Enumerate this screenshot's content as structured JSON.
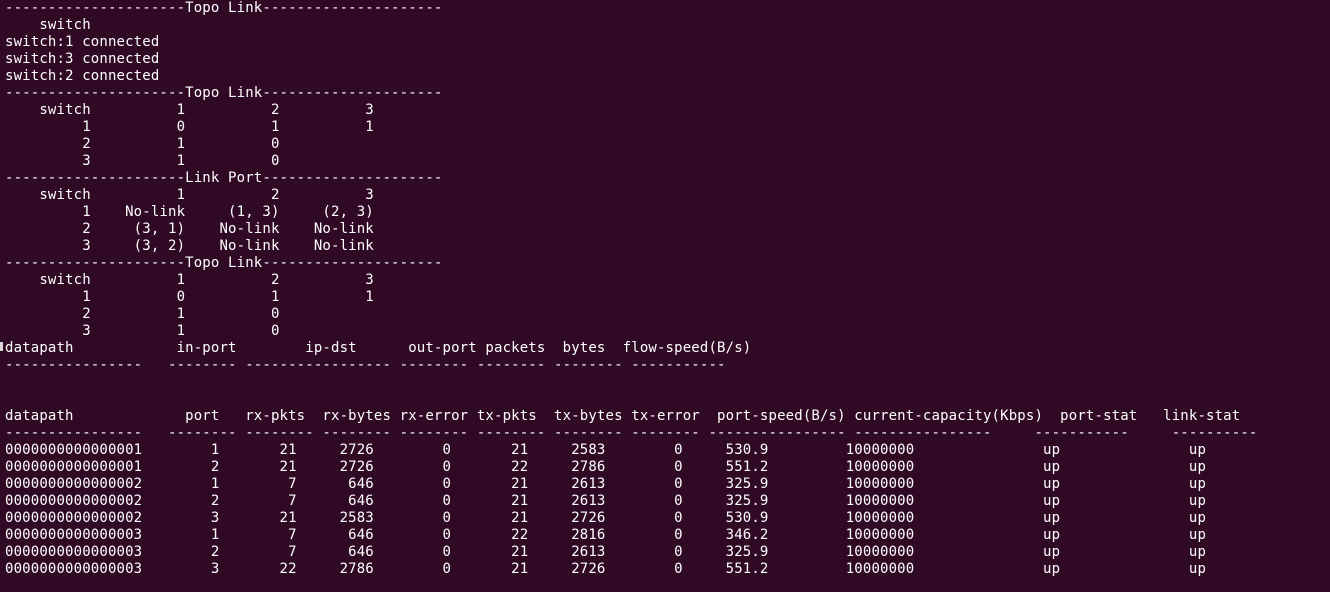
{
  "terminal": {
    "background": "#300a24",
    "foreground": "#ffffff",
    "lines": [
      "---------------------Topo Link---------------------",
      "    switch",
      "switch:1 connected",
      "switch:3 connected",
      "switch:2 connected",
      "---------------------Topo Link---------------------",
      "    switch          1          2          3",
      "         1          0          1          1",
      "         2          1          0",
      "         3          1          0",
      "---------------------Link Port---------------------",
      "    switch          1          2          3",
      "         1    No-link     (1, 3)     (2, 3)",
      "         2     (3, 1)    No-link    No-link",
      "         3     (3, 2)    No-link    No-link",
      "---------------------Topo Link---------------------",
      "    switch          1          2          3",
      "         1          0          1          1",
      "         2          1          0",
      "         3          1          0",
      "datapath            in-port        ip-dst      out-port packets  bytes  flow-speed(B/s)",
      "----------------   -------- ----------------- -------- -------- -------- -----------",
      "",
      "",
      "datapath             port   rx-pkts  rx-bytes rx-error tx-pkts  tx-bytes tx-error  port-speed(B/s) current-capacity(Kbps)  port-stat   link-stat",
      "----------------   -------- -------- -------- -------- -------- -------- -------- ---------------- ----------------     -----------     ----------",
      "0000000000000001        1       21     2726        0       21     2583        0     530.9         10000000               up               up",
      "0000000000000001        2       21     2726        0       22     2786        0     551.2         10000000               up               up",
      "0000000000000002        1        7      646        0       21     2613        0     325.9         10000000               up               up",
      "0000000000000002        2        7      646        0       21     2613        0     325.9         10000000               up               up",
      "0000000000000002        3       21     2583        0       21     2726        0     530.9         10000000               up               up",
      "0000000000000003        1        7      646        0       22     2816        0     346.2         10000000               up               up",
      "0000000000000003        2        7      646        0       21     2613        0     325.9         10000000               up               up",
      "0000000000000003        3       22     2786        0       21     2726        0     551.2         10000000               up               up"
    ]
  }
}
